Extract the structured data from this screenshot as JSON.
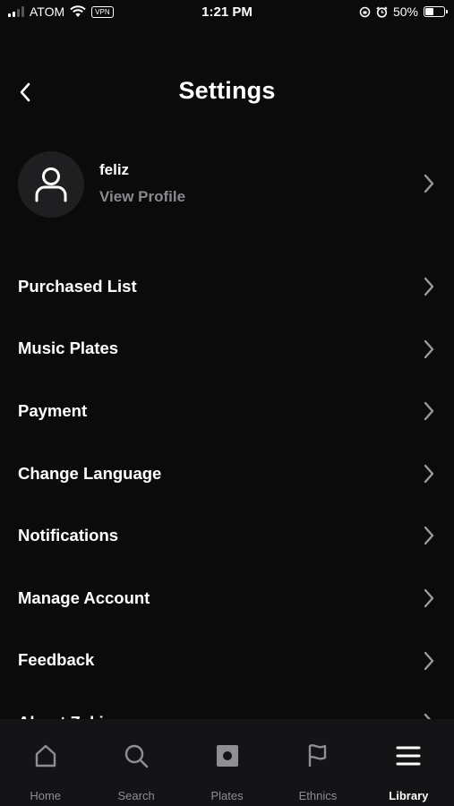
{
  "status_bar": {
    "carrier": "ATOM",
    "vpn": "VPN",
    "time": "1:21 PM",
    "battery": "50%",
    "battery_level": 0.5
  },
  "header": {
    "title": "Settings"
  },
  "profile": {
    "name": "feliz",
    "link": "View Profile"
  },
  "menu": [
    {
      "label": "Purchased List"
    },
    {
      "label": "Music Plates"
    },
    {
      "label": "Payment"
    },
    {
      "label": "Change Language"
    },
    {
      "label": "Notifications"
    },
    {
      "label": "Manage Account"
    },
    {
      "label": "Feedback"
    },
    {
      "label": "About Zaki"
    }
  ],
  "tabs": [
    {
      "label": "Home",
      "icon": "home-icon"
    },
    {
      "label": "Search",
      "icon": "search-icon"
    },
    {
      "label": "Plates",
      "icon": "plate-icon"
    },
    {
      "label": "Ethnics",
      "icon": "flag-icon"
    },
    {
      "label": "Library",
      "icon": "menu-icon",
      "active": true
    }
  ],
  "colors": {
    "background": "#0b0b0c",
    "tab_bar": "#141416",
    "muted_text": "#8a8a8f",
    "active_tab": "#ffffff"
  }
}
